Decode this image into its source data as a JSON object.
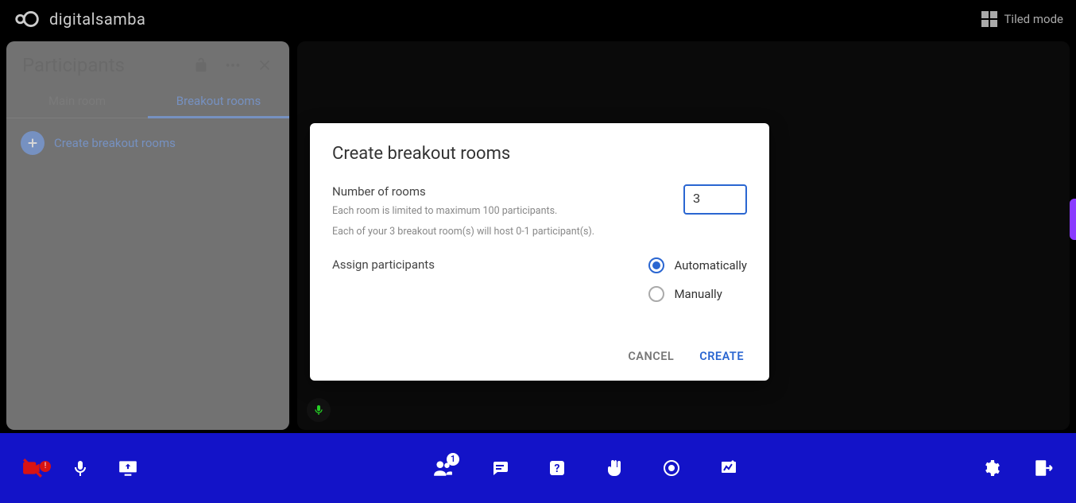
{
  "brand": {
    "name": "digitalsamba"
  },
  "top": {
    "tiled_mode": "Tiled mode"
  },
  "panel": {
    "title": "Participants",
    "tabs": {
      "main": "Main room",
      "breakout": "Breakout rooms"
    },
    "create_label": "Create breakout rooms"
  },
  "modal": {
    "title": "Create breakout rooms",
    "num_label": "Number of rooms",
    "help1": "Each room is limited to maximum 100 participants.",
    "help2": "Each of your 3 breakout room(s) will host 0-1 participant(s).",
    "num_value": "3",
    "assign_label": "Assign participants",
    "opt_auto": "Automatically",
    "opt_manual": "Manually",
    "cancel": "CANCEL",
    "create": "CREATE"
  },
  "bottom": {
    "participants_badge": "1"
  }
}
